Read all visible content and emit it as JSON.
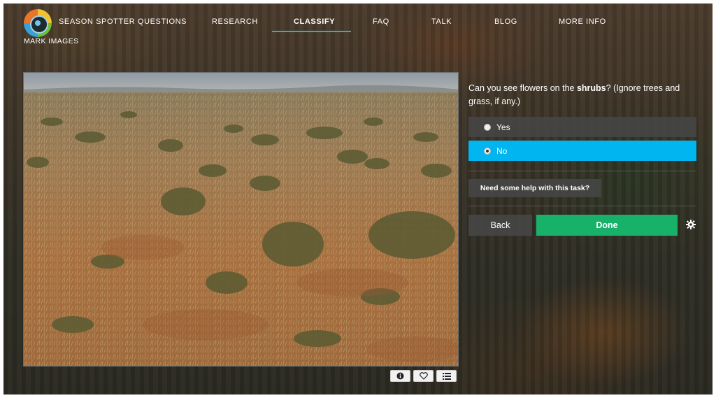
{
  "header": {
    "brand": "SEASON SPOTTER QUESTIONS",
    "subtitle": "MARK IMAGES",
    "nav": [
      {
        "label": "RESEARCH"
      },
      {
        "label": "CLASSIFY",
        "active": true
      },
      {
        "label": "FAQ"
      },
      {
        "label": "TALK"
      },
      {
        "label": "BLOG"
      },
      {
        "label": "MORE INFO"
      }
    ]
  },
  "task": {
    "question_prefix": "Can you see flowers on the ",
    "question_bold": "shrubs",
    "question_suffix": "? (Ignore trees and grass, if any.)",
    "answers": [
      {
        "label": "Yes",
        "selected": false
      },
      {
        "label": "No",
        "selected": true
      }
    ],
    "help_label": "Need some help with this task?",
    "back_label": "Back",
    "done_label": "Done"
  },
  "image_tools": [
    "info-icon",
    "heart-icon",
    "list-icon"
  ],
  "colors": {
    "accent": "#00b5f0",
    "done": "#18b16a",
    "nav_underline": "#16b2e8"
  }
}
